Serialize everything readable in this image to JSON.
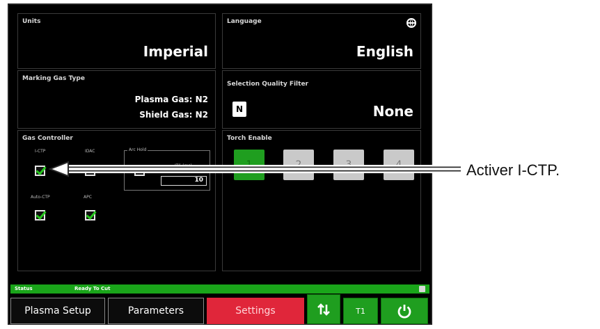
{
  "units": {
    "label": "Units",
    "value": "Imperial"
  },
  "language": {
    "label": "Language",
    "value": "English",
    "icon": "globe-icon"
  },
  "marking_gas": {
    "label": "Marking Gas Type",
    "plasma": "Plasma Gas: N2",
    "shield": "Shield Gas: N2"
  },
  "selection_filter": {
    "label": "Selection Quality Filter",
    "badge": "N",
    "value": "None"
  },
  "gas_controller": {
    "label": "Gas Controller",
    "items": [
      {
        "label": "I-CTP",
        "checked": true
      },
      {
        "label": "IDAC",
        "checked": false
      },
      {
        "label": "Auto-CTP",
        "checked": true
      },
      {
        "label": "APC",
        "checked": true
      }
    ],
    "arc_hold": {
      "label": "Arc Hold",
      "field_label": "ITS (ms)",
      "value": "10",
      "checked": false
    }
  },
  "torch_enable": {
    "label": "Torch Enable",
    "torches": [
      "1",
      "2",
      "3",
      "4"
    ],
    "active": "1"
  },
  "status": {
    "label": "Status",
    "value": "Ready To Cut"
  },
  "nav": {
    "plasma_setup": "Plasma Setup",
    "parameters": "Parameters",
    "settings": "Settings",
    "t1": "T1"
  },
  "callout": "Activer I-CTP.",
  "colors": {
    "accent_green": "#1f9e1f",
    "active_red": "#e0263a",
    "background": "#000000"
  }
}
